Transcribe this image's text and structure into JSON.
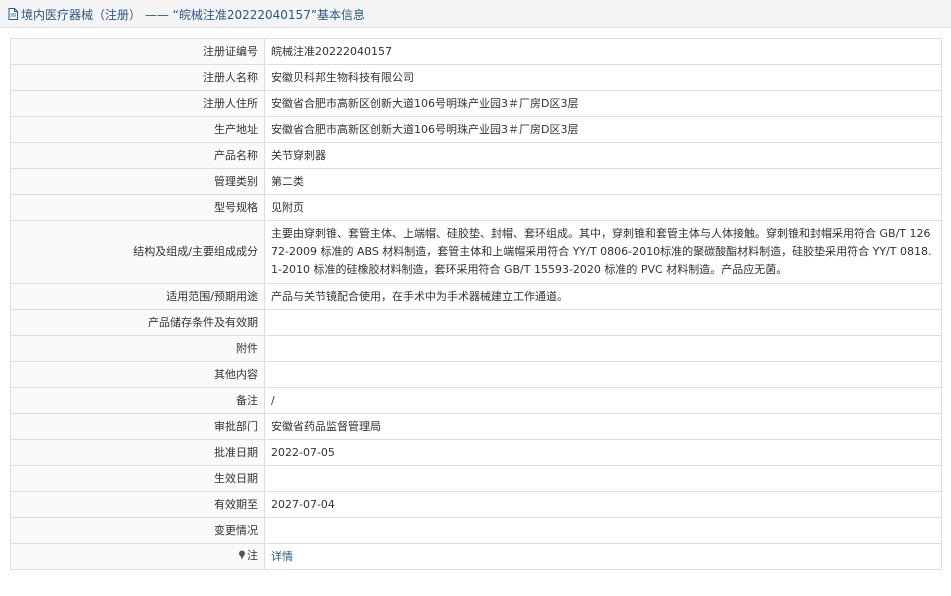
{
  "header": {
    "title": "境内医疗器械（注册） —— “皖械注准20222040157”基本信息"
  },
  "fields": [
    {
      "label": "注册证编号",
      "value": "皖械注准20222040157"
    },
    {
      "label": "注册人名称",
      "value": "安徽贝科邦生物科技有限公司"
    },
    {
      "label": "注册人住所",
      "value": "安徽省合肥市高新区创新大道106号明珠产业园3＃厂房D区3层"
    },
    {
      "label": "生产地址",
      "value": "安徽省合肥市高新区创新大道106号明珠产业园3＃厂房D区3层"
    },
    {
      "label": "产品名称",
      "value": "关节穿刺器"
    },
    {
      "label": "管理类别",
      "value": "第二类"
    },
    {
      "label": "型号规格",
      "value": "见附页"
    },
    {
      "label": "结构及组成/主要组成成分",
      "value": "主要由穿刺锥、套管主体、上端帽、硅胶垫、封帽、套环组成。其中，穿刺锥和套管主体与人体接触。穿刺锥和封帽采用符合 GB/T 12672-2009 标准的 ABS 材料制造，套管主体和上端帽采用符合 YY/T 0806-2010标准的聚碳酸酯材料制造，硅胶垫采用符合 YY/T 0818.1-2010 标准的硅橡胶材料制造，套环采用符合 GB/T 15593-2020 标准的 PVC 材料制造。产品应无菌。"
    },
    {
      "label": "适用范围/预期用途",
      "value": "产品与关节镜配合使用，在手术中为手术器械建立工作通道。"
    },
    {
      "label": "产品储存条件及有效期",
      "value": ""
    },
    {
      "label": "附件",
      "value": ""
    },
    {
      "label": "其他内容",
      "value": ""
    },
    {
      "label": "备注",
      "value": "/"
    },
    {
      "label": "审批部门",
      "value": "安徽省药品监督管理局"
    },
    {
      "label": "批准日期",
      "value": "2022-07-05"
    },
    {
      "label": "生效日期",
      "value": ""
    },
    {
      "label": "有效期至",
      "value": "2027-07-04"
    },
    {
      "label": "变更情况",
      "value": ""
    }
  ],
  "note": {
    "label": "注",
    "link_text": "详情"
  },
  "icons": {
    "title_icon": "document-icon",
    "note_icon": "pin-icon"
  },
  "colors": {
    "title": "#27598a",
    "link": "#27598a",
    "border": "#dddddd"
  }
}
